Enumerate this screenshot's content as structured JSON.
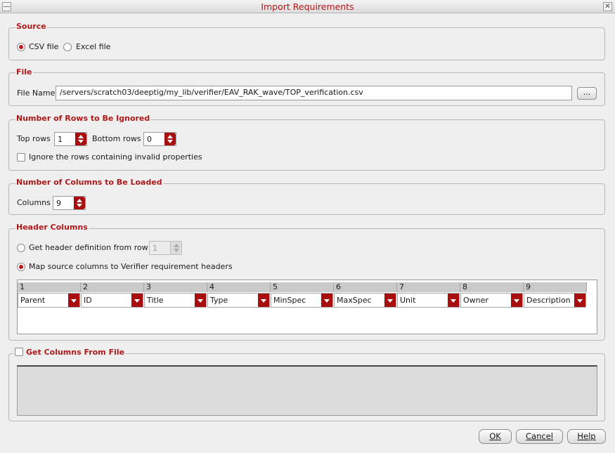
{
  "window": {
    "title": "Import Requirements"
  },
  "source": {
    "label": "Source",
    "options": [
      {
        "label": "CSV file",
        "selected": true
      },
      {
        "label": "Excel file",
        "selected": false
      }
    ]
  },
  "file": {
    "label": "File",
    "name_label": "File Name",
    "path": "/servers/scratch03/deeptig/my_lib/verifier/EAV_RAK_wave/TOP_verification.csv",
    "browse_label": "..."
  },
  "rows_ignored": {
    "label": "Number of Rows to Be Ignored",
    "top_label": "Top rows",
    "top_value": "1",
    "bottom_label": "Bottom rows",
    "bottom_value": "0",
    "invalid_label": "Ignore the rows containing invalid properties",
    "invalid_checked": false
  },
  "columns_loaded": {
    "label": "Number of Columns to Be Loaded",
    "columns_label": "Columns",
    "columns_value": "9"
  },
  "header_columns": {
    "label": "Header Columns",
    "from_row_label": "Get header definition from row",
    "from_row_value": "1",
    "map_label": "Map source columns to Verifier requirement headers",
    "columns": [
      {
        "num": "1",
        "value": "Parent"
      },
      {
        "num": "2",
        "value": "ID"
      },
      {
        "num": "3",
        "value": "Title"
      },
      {
        "num": "4",
        "value": "Type"
      },
      {
        "num": "5",
        "value": "MinSpec"
      },
      {
        "num": "6",
        "value": "MaxSpec"
      },
      {
        "num": "7",
        "value": "Unit"
      },
      {
        "num": "8",
        "value": "Owner"
      },
      {
        "num": "9",
        "value": "Description"
      }
    ]
  },
  "get_columns": {
    "label": "Get Columns From File",
    "checked": false
  },
  "buttons": {
    "ok": "OK",
    "cancel": "Cancel",
    "help": "Help"
  },
  "colors": {
    "accent": "#b01818",
    "spin": "#a80e0e"
  }
}
